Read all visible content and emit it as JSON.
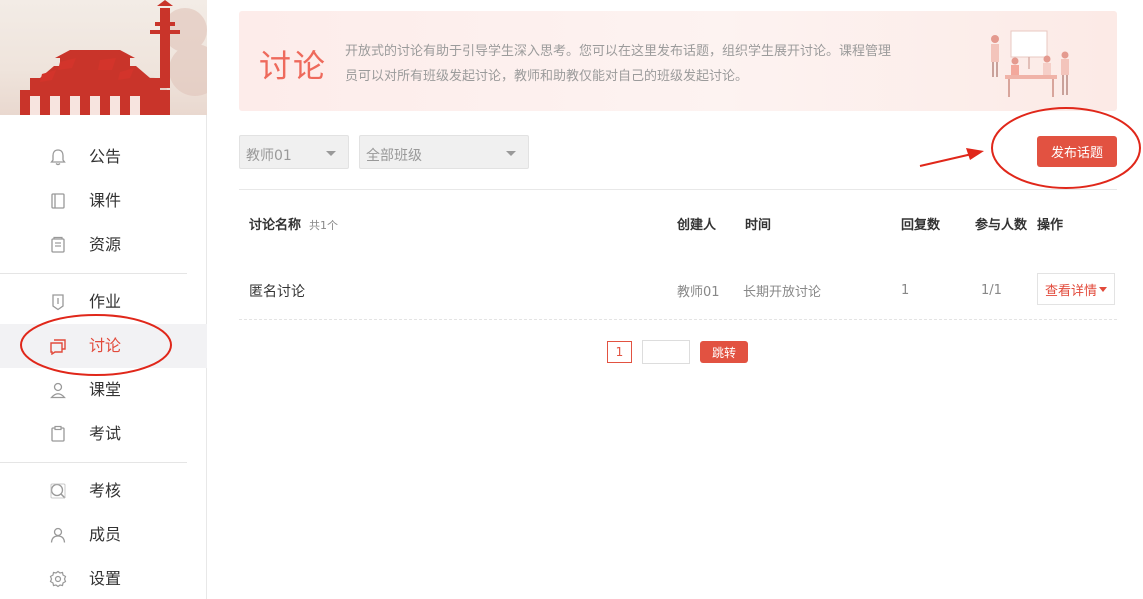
{
  "sidebar": {
    "items": [
      {
        "label": "公告",
        "icon": "bell-icon"
      },
      {
        "label": "课件",
        "icon": "book-icon"
      },
      {
        "label": "资源",
        "icon": "resource-icon"
      },
      {
        "label": "作业",
        "icon": "homework-icon"
      },
      {
        "label": "讨论",
        "icon": "chat-icon",
        "active": true
      },
      {
        "label": "课堂",
        "icon": "classroom-icon"
      },
      {
        "label": "考试",
        "icon": "exam-icon"
      },
      {
        "label": "考核",
        "icon": "assessment-icon"
      },
      {
        "label": "成员",
        "icon": "members-icon"
      },
      {
        "label": "设置",
        "icon": "gear-icon"
      }
    ]
  },
  "hero": {
    "title": "讨论",
    "desc_line1": "开放式的讨论有助于引导学生深入思考。您可以在这里发布话题，组织学生展开讨论。课程管理",
    "desc_line2": "员可以对所有班级发起讨论，教师和助教仅能对自己的班级发起讨论。"
  },
  "filters": {
    "teacher": "教师01",
    "class": "全部班级"
  },
  "toolbar": {
    "publish_label": "发布话题"
  },
  "table": {
    "headers": {
      "name": "讨论名称",
      "count": "共1个",
      "creator": "创建人",
      "time": "时间",
      "replies": "回复数",
      "participants": "参与人数",
      "actions": "操作"
    },
    "rows": [
      {
        "name": "匿名讨论",
        "creator": "教师01",
        "time": "长期开放讨论",
        "replies": "1",
        "participants": "1/1",
        "action_label": "查看详情"
      }
    ]
  },
  "pagination": {
    "current_page": "1",
    "jump_label": "跳转"
  },
  "colors": {
    "accent": "#e25241",
    "active_text": "#e24a3b",
    "annotation": "#e0271a"
  }
}
